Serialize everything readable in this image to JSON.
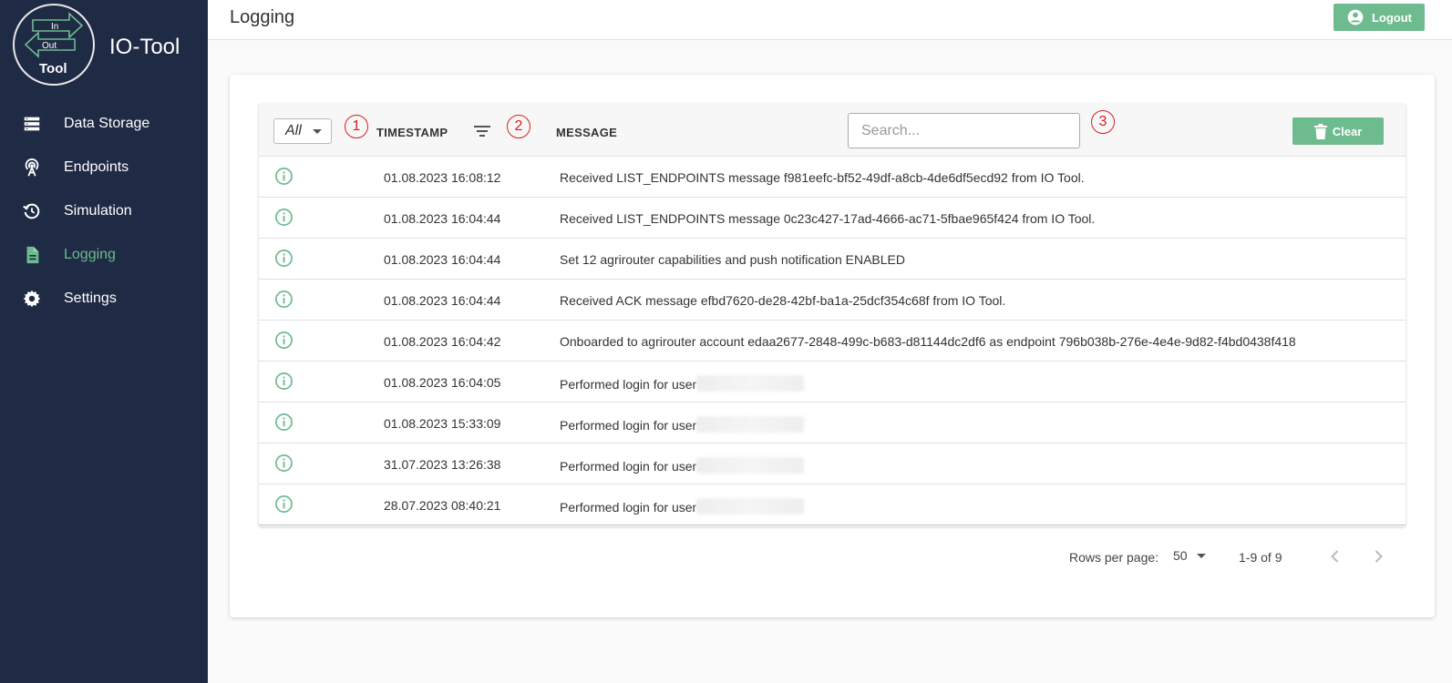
{
  "app": {
    "title": "IO-Tool",
    "logo_text": {
      "in": "In",
      "out": "Out",
      "tool": "Tool"
    }
  },
  "sidebar": {
    "items": [
      {
        "label": "Data Storage",
        "icon": "storage-icon",
        "active": false
      },
      {
        "label": "Endpoints",
        "icon": "antenna-icon",
        "active": false
      },
      {
        "label": "Simulation",
        "icon": "restore-clock-icon",
        "active": false
      },
      {
        "label": "Logging",
        "icon": "document-icon",
        "active": true
      },
      {
        "label": "Settings",
        "icon": "gear-icon",
        "active": false
      }
    ]
  },
  "header": {
    "title": "Logging",
    "logout_label": "Logout"
  },
  "colors": {
    "accent": "#6dbb8f",
    "sidebar_bg": "#1f2a44",
    "marker": "#d62020"
  },
  "table": {
    "filter_value": "All",
    "markers": [
      "1",
      "2",
      "3"
    ],
    "columns": {
      "timestamp": "TIMESTAMP",
      "message": "MESSAGE"
    },
    "search_placeholder": "Search...",
    "clear_label": "Clear",
    "rows": [
      {
        "time": "01.08.2023 16:08:12",
        "message": "Received LIST_ENDPOINTS message f981eefc-bf52-49df-a8cb-4de6df5ecd92 from IO Tool."
      },
      {
        "time": "01.08.2023 16:04:44",
        "message": "Received LIST_ENDPOINTS message 0c23c427-17ad-4666-ac71-5fbae965f424 from IO Tool."
      },
      {
        "time": "01.08.2023 16:04:44",
        "message": "Set 12 agrirouter capabilities and push notification ENABLED"
      },
      {
        "time": "01.08.2023 16:04:44",
        "message": "Received ACK message efbd7620-de28-42bf-ba1a-25dcf354c68f from IO Tool."
      },
      {
        "time": "01.08.2023 16:04:42",
        "message": "Onboarded to agrirouter account edaa2677-2848-499c-b683-d81144dc2df6 as endpoint 796b038b-276e-4e4e-9d82-f4bd0438f418"
      },
      {
        "time": "01.08.2023 16:04:05",
        "message": "Performed login for user"
      },
      {
        "time": "01.08.2023 15:33:09",
        "message": "Performed login for user"
      },
      {
        "time": "31.07.2023 13:26:38",
        "message": "Performed login for user"
      },
      {
        "time": "28.07.2023 08:40:21",
        "message": "Performed login for user"
      }
    ]
  },
  "pagination": {
    "rows_per_page_label": "Rows per page:",
    "rows_per_page": "50",
    "range": "1-9 of 9"
  }
}
